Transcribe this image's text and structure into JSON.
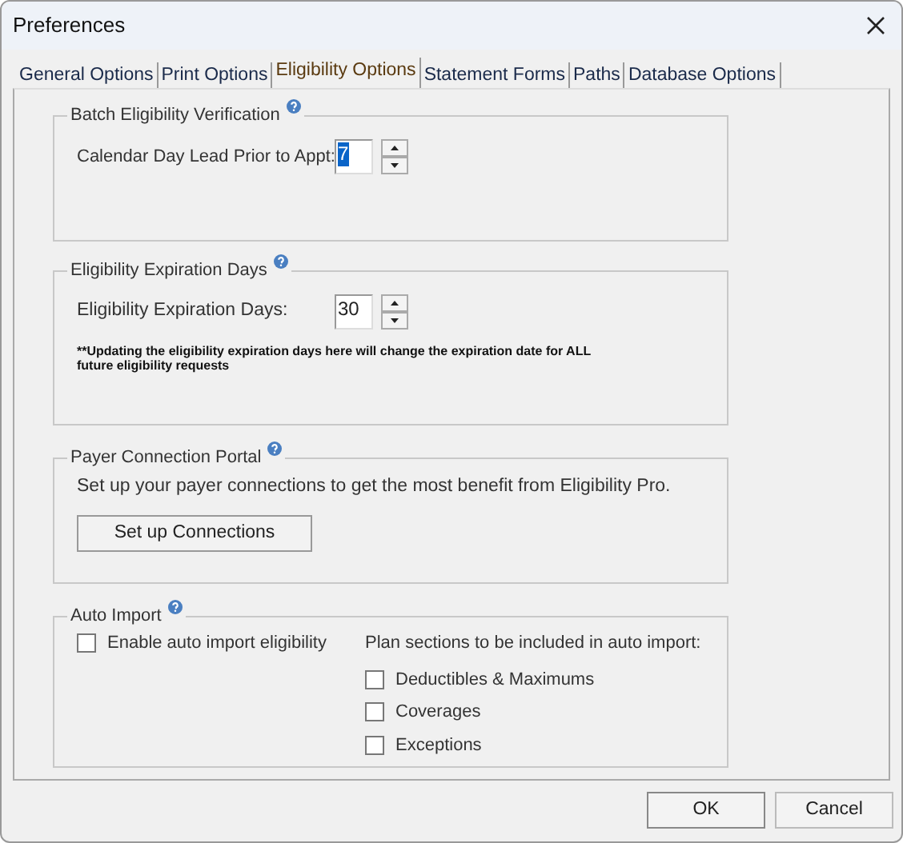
{
  "window": {
    "title": "Preferences"
  },
  "tabs": [
    {
      "label": "General Options",
      "selected": false
    },
    {
      "label": "Print Options",
      "selected": false
    },
    {
      "label": "Eligibility Options",
      "selected": true
    },
    {
      "label": "Statement Forms",
      "selected": false
    },
    {
      "label": "Paths",
      "selected": false
    },
    {
      "label": "Database Options",
      "selected": false
    }
  ],
  "batch_eligibility": {
    "title": "Batch Eligibility Verification",
    "label": "Calendar Day Lead Prior to Appt:",
    "value": "7",
    "value_selected": true
  },
  "expiration": {
    "title": "Eligibility Expiration Days",
    "label": "Eligibility Expiration Days:",
    "value": "30",
    "value_selected": false,
    "note": "**Updating the eligibility expiration days here will change the expiration date for ALL future eligibility requests"
  },
  "payer_portal": {
    "title": "Payer Connection Portal",
    "text": "Set up your payer connections to get the most benefit from Eligibility Pro.",
    "button": "Set up Connections"
  },
  "auto_import": {
    "title": "Auto Import",
    "enable": {
      "label": "Enable auto import eligibility",
      "checked": false
    },
    "sections_label": "Plan sections to be included in auto import:",
    "sections": [
      {
        "label": "Deductibles & Maximums",
        "checked": false
      },
      {
        "label": "Coverages",
        "checked": false
      },
      {
        "label": "Exceptions",
        "checked": false
      }
    ]
  },
  "buttons": [
    "OK",
    "Cancel"
  ]
}
